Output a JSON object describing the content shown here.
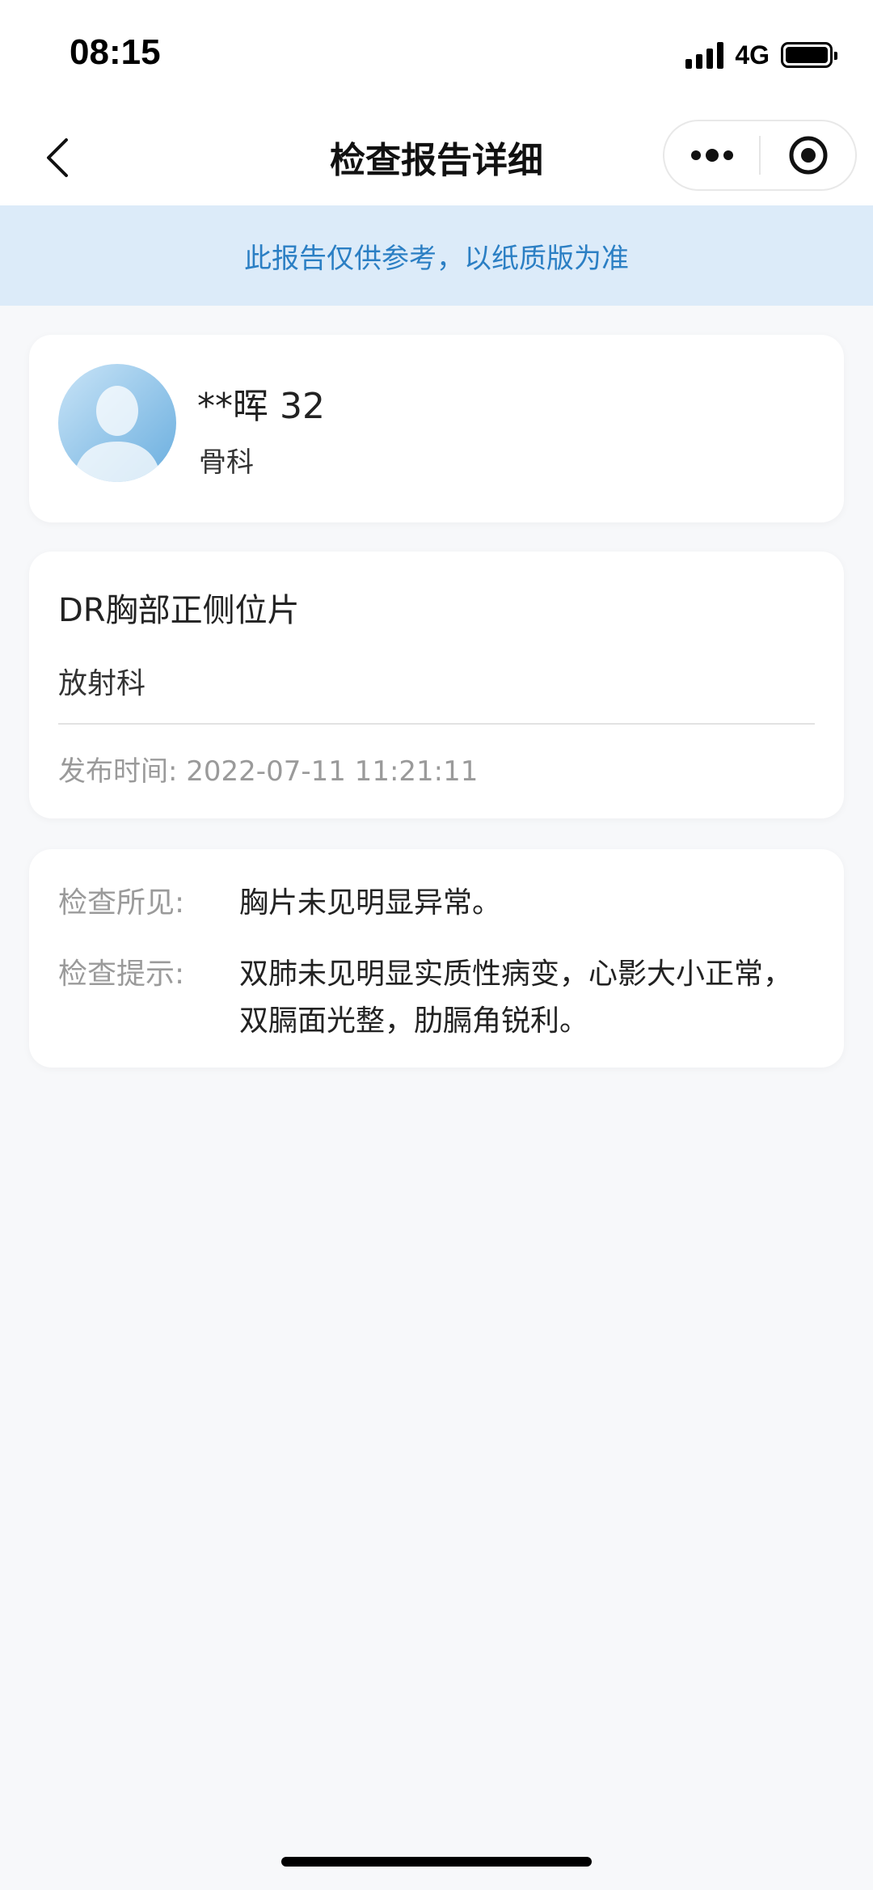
{
  "status_bar": {
    "time": "08:15",
    "network": "4G",
    "battery_level": 1.0,
    "icons": [
      "signal-icon",
      "battery-icon"
    ]
  },
  "nav": {
    "title": "检查报告详细",
    "back_icon": "chevron-left-icon",
    "more_icon": "more-dots-icon",
    "close_icon": "target-circle-icon"
  },
  "notice": {
    "text": "此报告仅供参考，以纸质版为准",
    "text_color": "#2b7fc4",
    "background": "#dcebf9"
  },
  "patient": {
    "name_age": "**晖 32",
    "department": "骨科",
    "avatar_icon": "avatar-silhouette-icon"
  },
  "exam": {
    "name": "DR胸部正侧位片",
    "department": "放射科",
    "publish_label": "发布时间:",
    "publish_time": "2022-07-11 11:21:11"
  },
  "findings": {
    "label_findings": "检查所见:",
    "value_findings": "胸片未见明显异常。",
    "label_hint": "检查提示:",
    "value_hint": "双肺未见明显实质性病变，心影大小正常，双膈面光整，肋膈角锐利。"
  }
}
